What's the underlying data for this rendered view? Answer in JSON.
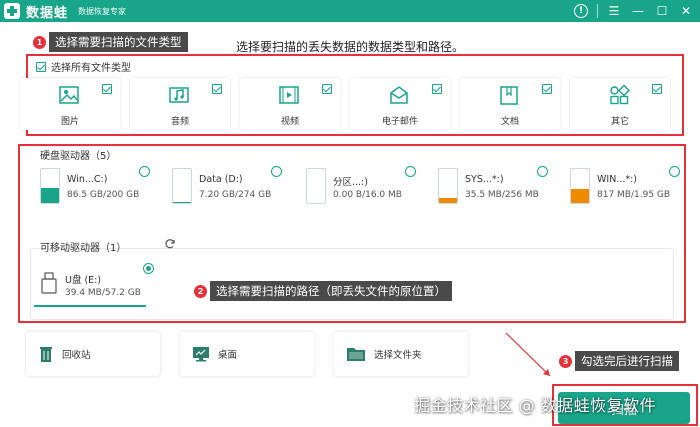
{
  "app": {
    "name": "数据蛙",
    "subtitle": "数据恢复专家"
  },
  "instruction": "选择要扫描的丢失数据的数据类型和路径。",
  "annotations": [
    {
      "num": "1",
      "text": "选择需要扫描的文件类型"
    },
    {
      "num": "2",
      "text": "选择需要扫描的路径（即丢失文件的原位置）"
    },
    {
      "num": "3",
      "text": "勾选完后进行扫描"
    }
  ],
  "file_types": {
    "select_all": "选择所有文件类型",
    "items": [
      {
        "label": "图片",
        "icon": "image-icon"
      },
      {
        "label": "音频",
        "icon": "music-icon"
      },
      {
        "label": "视频",
        "icon": "video-icon"
      },
      {
        "label": "电子邮件",
        "icon": "email-icon"
      },
      {
        "label": "文档",
        "icon": "document-icon"
      },
      {
        "label": "其它",
        "icon": "apps-icon"
      }
    ]
  },
  "hard_drives": {
    "title": "硬盘驱动器（5）",
    "items": [
      {
        "name": "Win...C:)",
        "size": "86.5 GB/200 GB",
        "fill": 0.43,
        "color": "#18a58a"
      },
      {
        "name": "Data (D:)",
        "size": "7.20 GB/274 GB",
        "fill": 0.03,
        "color": "#18a58a"
      },
      {
        "name": "分区...:)",
        "size": "0.00  B/16.0 MB",
        "fill": 0.0,
        "color": "#18a58a"
      },
      {
        "name": "SYS...*:)",
        "size": "35.5 MB/256 MB",
        "fill": 0.14,
        "color": "#f08a00"
      },
      {
        "name": "WIN...*:)",
        "size": "817 MB/1.95 GB",
        "fill": 0.42,
        "color": "#f08a00"
      }
    ]
  },
  "removable": {
    "title": "可移动驱动器（1）",
    "items": [
      {
        "name": "U盘 (E:)",
        "size": "39.4 MB/57.2 GB"
      }
    ]
  },
  "locations": [
    {
      "label": "回收站",
      "icon": "recycle-bin-icon"
    },
    {
      "label": "桌面",
      "icon": "desktop-icon"
    },
    {
      "label": "选择文件夹",
      "icon": "folder-icon"
    }
  ],
  "scan_button": "扫描",
  "watermark": "掘金技术社区 @ 数据蛙恢复软件",
  "colors": {
    "brand": "#18a58a",
    "annotation": "#e5313a",
    "warning": "#f08a00"
  }
}
